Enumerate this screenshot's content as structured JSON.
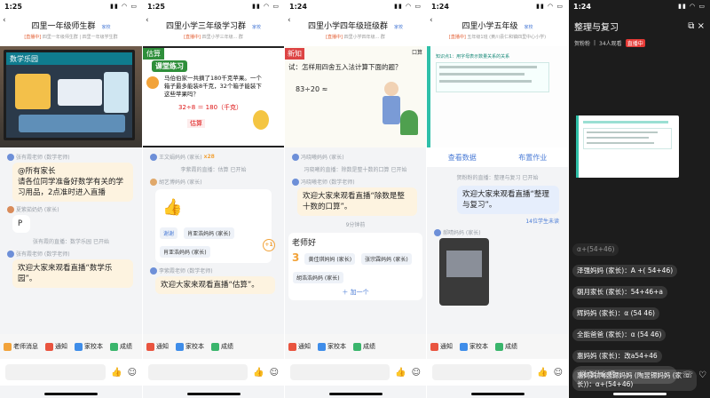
{
  "colors": {
    "accent": "#4a7bd6",
    "live": "#e25b2f",
    "bubble": "#fdf3e0",
    "dark": "#1c1c1c"
  },
  "common": {
    "tabs": [
      "老师消息",
      "通知",
      "家校本",
      "成绩"
    ],
    "input_icon": "thumbs-up-icon",
    "emoji_icon": "emoji-icon"
  },
  "p1": {
    "time": "1:25",
    "title": "四里一年级师生群",
    "badge": "家校",
    "sub_live": "[直播中]",
    "sub": "四里一年级师生群 | 四里一年级学生群",
    "video_caption": "数学乐园",
    "messages": [
      {
        "sender": "张有霞老师 (数学老师)",
        "text": "@所有家长\n请各位同学准备好数学有关的学习用品，2点准时进入直播"
      },
      {
        "sender": "夏紫茹奶奶 (家长)",
        "text": "P",
        "style": "white"
      },
      {
        "sys": "张有霞的直播：数学乐园 已开始"
      },
      {
        "sender": "张有霞老师 (数学老师)",
        "text": "欢迎大家来观看直播“数学乐园”。"
      }
    ]
  },
  "p2": {
    "time": "1:25",
    "title": "四里小学三年级学习群",
    "badge": "家校",
    "sub_live": "[直播中]",
    "sub": "四里小学三年级... 群",
    "video_tag": "估算",
    "video_heading": "课堂练习",
    "video_text": "马伯伯家一共摘了180千克苹果。一个箱子最多能装8千克，32个箱子能装下这些苹果吗？",
    "video_eq": "32÷8 ＝ 180（千克）",
    "video_label": "估算",
    "messages": [
      {
        "sender": "王文娟妈妈 (家长)",
        "text": ""
      },
      {
        "sys": "李紫霞的直播：估算 已开始"
      },
      {
        "sender": "胡艺博妈妈 (家长)",
        "card": true
      },
      {
        "sender": "李紫霞老师 (数学老师)",
        "text": "欢迎大家来观看直播“估算”。"
      }
    ],
    "card_chips": [
      "谢谢",
      "肖亚浩妈妈 (家长)",
      "肖亚浩妈妈 (家长)"
    ],
    "plus_one": "+1"
  },
  "p3": {
    "time": "1:24",
    "title": "四里小学四年级班级群",
    "badge": "家校",
    "sub_live": "[直播中]",
    "sub": "四里小学四年级... 群",
    "video_corner": "口算",
    "video_tag": "新知",
    "video_text": "试：怎样用四舍五入法计算下面的题？",
    "video_eq": "83÷20 ≈",
    "messages": [
      {
        "sender": "冯晓曦妈妈 (家长)",
        "text": ""
      },
      {
        "sys": "冯晓曦的直播：除数是整十数的口算 已开始"
      },
      {
        "sender": "冯晓曦老师 (数学老师)",
        "text": "欢迎大家来观看直播“除数是整十数的口算”。"
      },
      {
        "sys": "9分钟前"
      },
      {
        "text": "老师好",
        "style": "white"
      }
    ],
    "card_chips": [
      "黄佳琪妈妈 (家长)",
      "张宗霖妈妈 (家长)",
      "胡浩浩妈妈 (家长)"
    ],
    "add_one": "加一个"
  },
  "p4": {
    "time": "1:24",
    "title": "四里小学五年级",
    "badge": "家校",
    "sub_live": "[直播中]",
    "sub": "五年级1班 (黄川县仁和镇四里中心小学)",
    "video_text": "知识点1：用字母表示数量关系的关系",
    "actions": [
      "查看数据",
      "布置作业"
    ],
    "messages": [
      {
        "sys": "贺粉粉的直播：整理与复习 已开始"
      },
      {
        "sender": "",
        "text": "欢迎大家来观看直播“整理与复习”。",
        "style": "blue"
      },
      {
        "sys": "14位学生未读"
      },
      {
        "sender": "郝晴妈妈 (家长)",
        "text": ""
      }
    ]
  },
  "p5": {
    "time": "1:24",
    "title": "整理与复习",
    "host": "贺粉粉",
    "viewers": "34人观看",
    "live": "直播中",
    "messages": [
      "α+(54+46)",
      "泽强妈妈 (家长)：A +( 54+46)",
      "朝月家长 (家长)：54+46+a",
      "辉妈妈 (家长)：α (54 46)",
      "全能爸爸 (家长)：α (54 46)",
      "惠妈妈 (家长)：改a54+46",
      "惠妈妈/陶昱锶妈妈 (陶昱锶妈妈 (家长))：α+(54+46)"
    ],
    "input_placeholder": "说点什么吧"
  }
}
